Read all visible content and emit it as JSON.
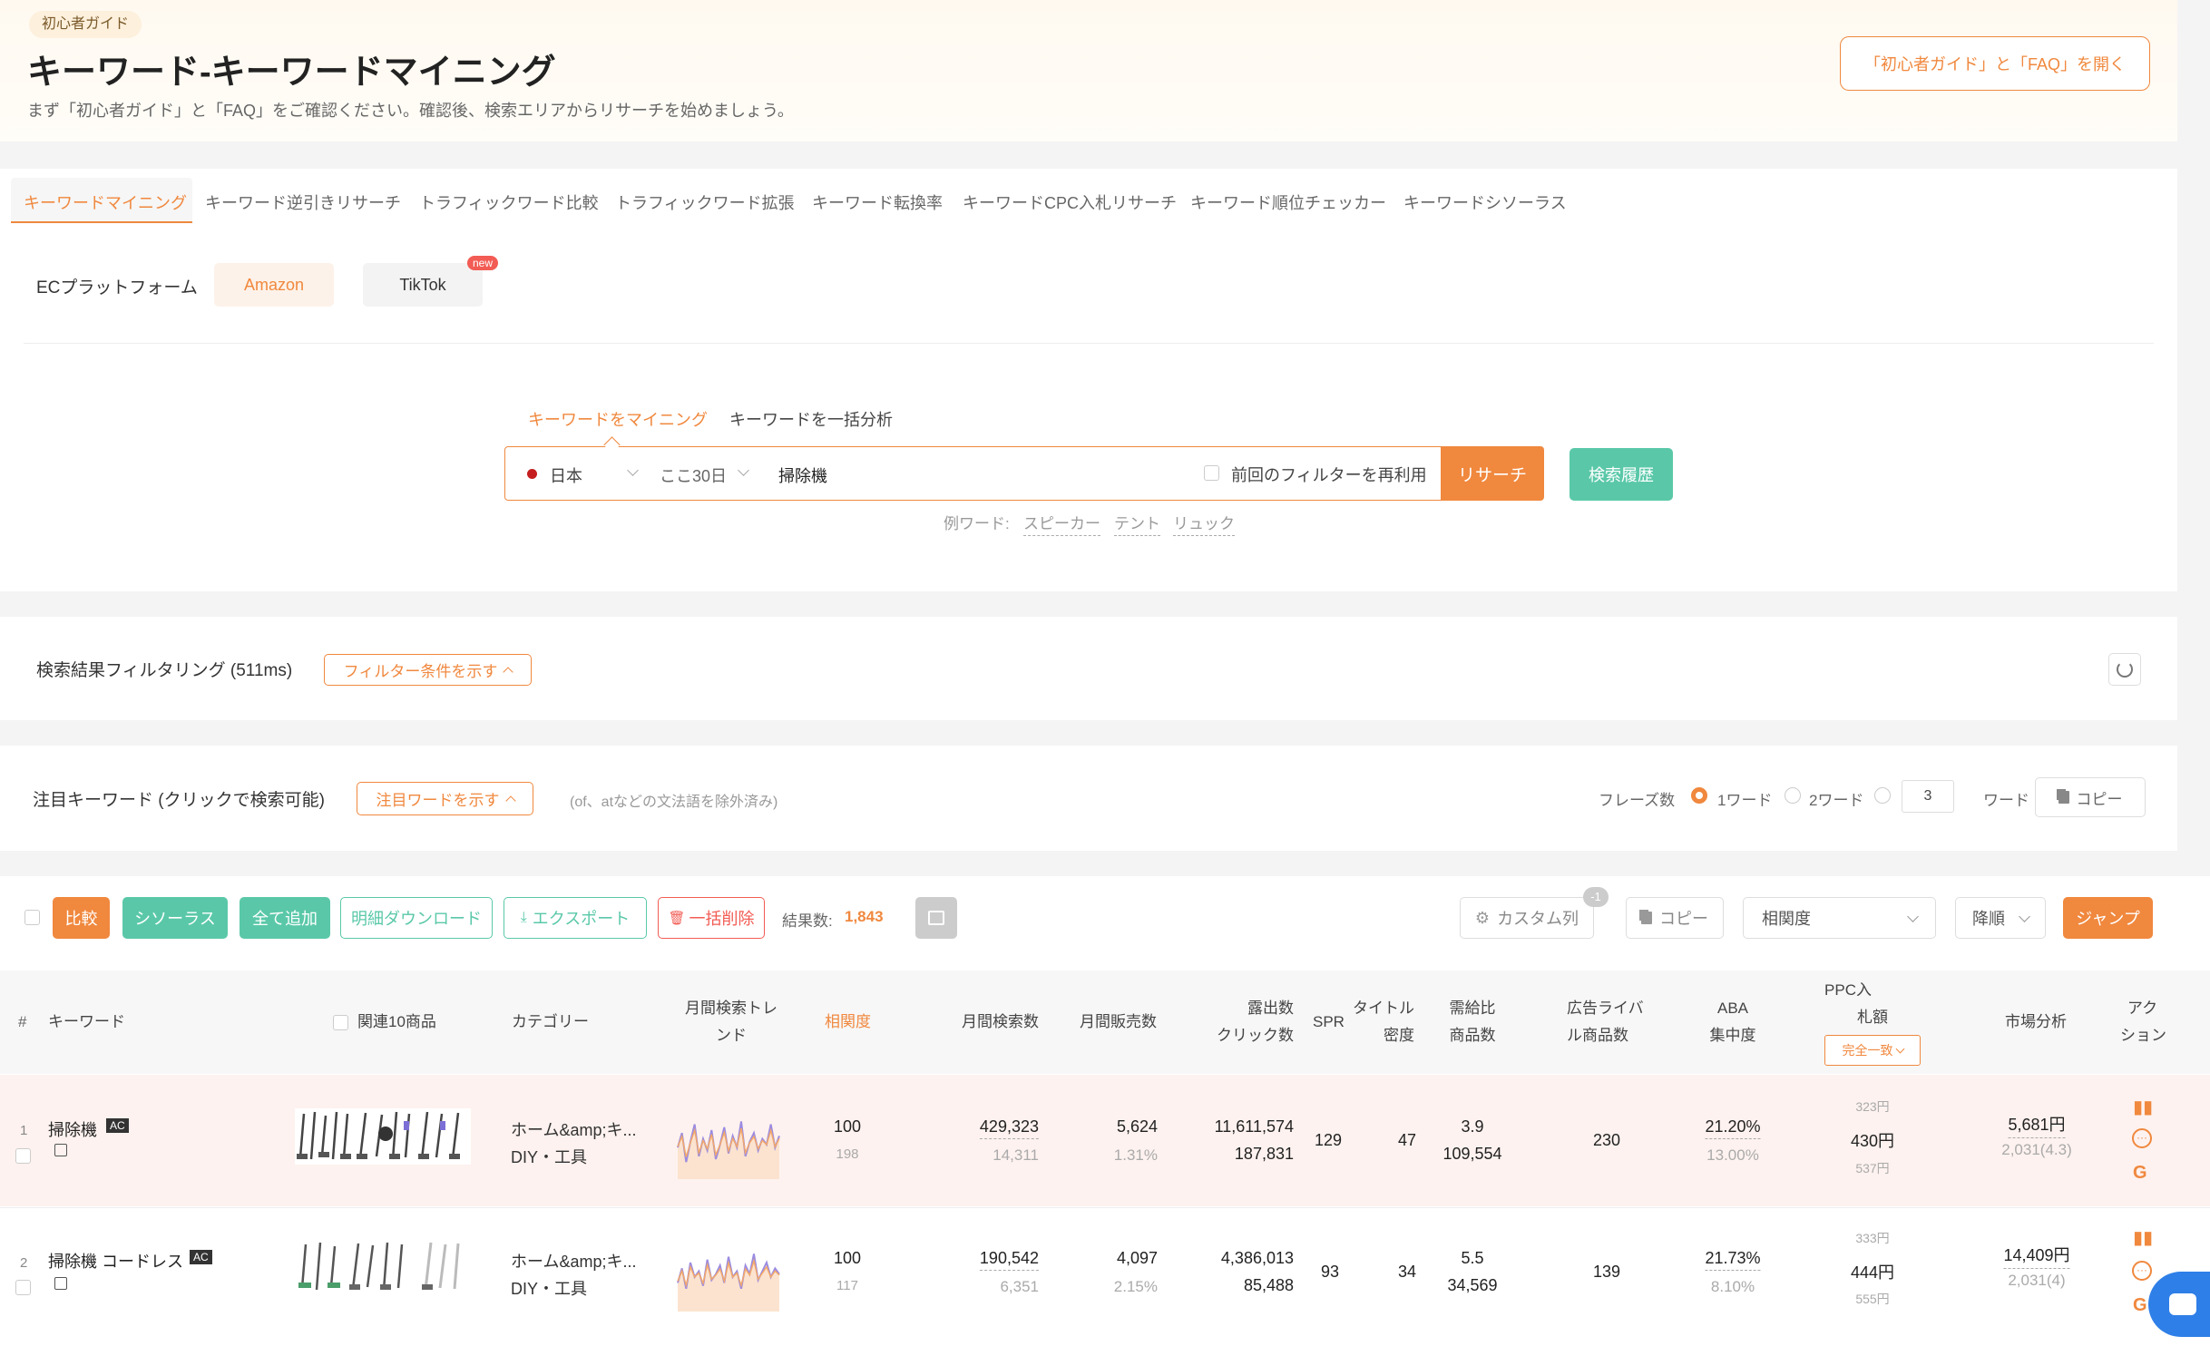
{
  "header": {
    "badge": "初心者ガイド",
    "title": "キーワード-キーワードマイニング",
    "subtitle": "まず「初心者ガイド」と「FAQ」をご確認ください。確認後、検索エリアからリサーチを始めましょう。",
    "guide_button": "「初心者ガイド」と「FAQ」を開く"
  },
  "tabs": [
    "キーワードマイニング",
    "キーワード逆引きリサーチ",
    "トラフィックワード比較",
    "トラフィックワード拡張",
    "キーワード転換率",
    "キーワードCPC入札リサーチ",
    "キーワード順位チェッカー",
    "キーワードシソーラス"
  ],
  "platform": {
    "label": "ECプラットフォーム",
    "amazon": "Amazon",
    "tiktok": "TikTok",
    "new_badge": "new"
  },
  "search": {
    "mode_tabs": [
      "キーワードをマイニング",
      "キーワードを一括分析"
    ],
    "country": "日本",
    "period": "ここ30日",
    "query": "掃除機",
    "reuse_filter": "前回のフィルターを再利用",
    "search_button": "リサーチ",
    "history_button": "検索履歴",
    "examples_label": "例ワード:",
    "examples": [
      "スピーカー",
      "テント",
      "リュック"
    ]
  },
  "filter": {
    "label": "検索結果フィルタリング (511ms)",
    "toggle": "フィルター条件を示す"
  },
  "focus": {
    "label": "注目キーワード (クリックで検索可能)",
    "toggle": "注目ワードを示す",
    "note": "(of、atなどの文法語を除外済み)",
    "phrase_label": "フレーズ数",
    "opt1": "1ワード",
    "opt2": "2ワード",
    "custom_value": "3",
    "word_suffix": "ワード",
    "copy": "コピー"
  },
  "toolbar": {
    "compare": "比較",
    "thesaurus": "シソーラス",
    "add_all": "全て追加",
    "detail_download": "明細ダウンロード",
    "export": "エクスポート",
    "bulk_delete": "一括削除",
    "result_label": "結果数:",
    "result_count": "1,843",
    "custom_columns": "カスタム列",
    "custom_badge": "-1",
    "copy": "コピー",
    "sort_field": "相関度",
    "sort_order": "降順",
    "jump": "ジャンプ"
  },
  "table": {
    "headers": {
      "num": "#",
      "keyword": "キーワード",
      "related": "関連10商品",
      "category": "カテゴリー",
      "trend_1": "月間検索トレ",
      "trend_2": "ンド",
      "relevance": "相関度",
      "monthly_search": "月間検索数",
      "monthly_sales": "月間販売数",
      "impressions": "露出数",
      "clicks": "クリック数",
      "spr": "SPR",
      "title_1": "タイトル",
      "title_2": "密度",
      "supply_1": "需給比",
      "supply_2": "商品数",
      "ad_1": "広告ライバ",
      "ad_2": "ル商品数",
      "aba_1": "ABA",
      "aba_2": "集中度",
      "ppc_1": "PPC入",
      "ppc_2": "札額",
      "ppc_match": "完全一致",
      "market": "市場分析",
      "action_1": "アク",
      "action_2": "ション"
    },
    "rows": [
      {
        "num": "1",
        "keyword": "掃除機",
        "tag": "AC",
        "category_1": "ホーム&amp;キ...",
        "category_2": "DIY・工具",
        "relevance": "100",
        "relevance_sub": "198",
        "monthly_search": "429,323",
        "monthly_search_sub": "14,311",
        "monthly_sales": "5,624",
        "monthly_sales_sub": "1.31%",
        "impressions": "11,611,574",
        "clicks": "187,831",
        "spr": "129",
        "title_density": "47",
        "supply_ratio": "3.9",
        "product_count": "109,554",
        "ad_rivals": "230",
        "aba": "21.20%",
        "aba_sub": "13.00%",
        "ppc_low": "323円",
        "ppc_mid": "430円",
        "ppc_high": "537円",
        "market": "5,681円",
        "market_sub": "2,031(4.3)",
        "trend": [
          0.45,
          0.7,
          0.2,
          0.55,
          0.85,
          0.3,
          0.6,
          0.4,
          0.75,
          0.25,
          0.5,
          0.8,
          0.35,
          0.65,
          0.45,
          0.9,
          0.3,
          0.55,
          0.7,
          0.4,
          0.6,
          0.5,
          0.85,
          0.45,
          0.65
        ]
      },
      {
        "num": "2",
        "keyword": "掃除機 コードレス",
        "tag": "AC",
        "category_1": "ホーム&amp;キ...",
        "category_2": "DIY・工具",
        "relevance": "100",
        "relevance_sub": "117",
        "monthly_search": "190,542",
        "monthly_search_sub": "6,351",
        "monthly_sales": "4,097",
        "monthly_sales_sub": "2.15%",
        "impressions": "4,386,013",
        "clicks": "85,488",
        "spr": "93",
        "title_density": "34",
        "supply_ratio": "5.5",
        "product_count": "34,569",
        "ad_rivals": "139",
        "aba": "21.73%",
        "aba_sub": "8.10%",
        "ppc_low": "333円",
        "ppc_mid": "444円",
        "ppc_high": "555円",
        "market": "14,409円",
        "market_sub": "2,031(4)",
        "trend": [
          0.4,
          0.65,
          0.3,
          0.75,
          0.5,
          0.6,
          0.35,
          0.8,
          0.45,
          0.55,
          0.7,
          0.4,
          0.85,
          0.5,
          0.6,
          0.3,
          0.7,
          0.55,
          0.9,
          0.45,
          0.6,
          0.75,
          0.5,
          0.65,
          0.55
        ]
      }
    ]
  },
  "colors": {
    "accent": "#f0883e",
    "green": "#5ac8a8",
    "red": "#f25c54",
    "row_highlight": "#fdf2ef"
  }
}
